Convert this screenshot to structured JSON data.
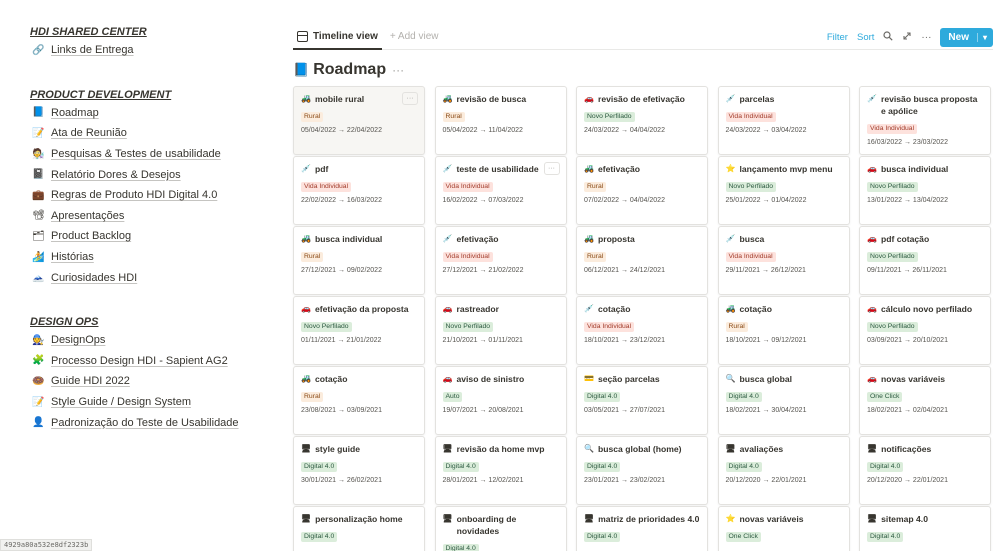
{
  "sidebar": {
    "sections": [
      {
        "title": "HDI SHARED CENTER",
        "items": [
          {
            "label": "Links de Entrega",
            "icon": "🔗"
          }
        ]
      },
      {
        "title": "PRODUCT DEVELOPMENT",
        "items": [
          {
            "label": "Roadmap",
            "icon": "📘"
          },
          {
            "label": "Ata de Reunião",
            "icon": "📝"
          },
          {
            "label": "Pesquisas & Testes de usabilidade",
            "icon": "🧑‍🔬"
          },
          {
            "label": "Relatório Dores & Desejos",
            "icon": "📓"
          },
          {
            "label": "Regras de Produto HDI Digital 4.0",
            "icon": "💼"
          },
          {
            "label": "Apresentações",
            "icon": "📽"
          },
          {
            "label": "Product Backlog",
            "icon": "🗂"
          },
          {
            "label": "Histórias",
            "icon": "🏄"
          },
          {
            "label": "Curiosidades HDI",
            "icon": "🗻"
          }
        ]
      },
      {
        "title": "DESIGN OPS",
        "items": [
          {
            "label": "DesignOps",
            "icon": "🧑‍🔧"
          },
          {
            "label": "Processo Design HDI - Sapient AG2",
            "icon": "🧩"
          },
          {
            "label": "Guide HDI 2022",
            "icon": "🍩"
          },
          {
            "label": "Style Guide / Design System",
            "icon": "📝"
          },
          {
            "label": "Padronização do Teste de Usabilidade",
            "icon": "👤"
          }
        ]
      }
    ]
  },
  "header": {
    "view_tab": "Timeline view",
    "add_view": "+ Add view",
    "filter": "Filter",
    "sort": "Sort",
    "new_button": "New"
  },
  "page": {
    "icon": "📘",
    "title": "Roadmap",
    "more": "···"
  },
  "cards": [
    {
      "title": "mobile rural",
      "icon": "🚜",
      "tag": "Rural",
      "tag_kind": "rural",
      "date": "05/04/2022 → 22/04/2022",
      "highlighted": true
    },
    {
      "title": "revisão de busca",
      "icon": "🚜",
      "tag": "Rural",
      "tag_kind": "rural",
      "date": "05/04/2022 → 11/04/2022"
    },
    {
      "title": "revisão de efetivação",
      "icon": "🚗",
      "tag": "Novo Perfilado",
      "tag_kind": "novo",
      "date": "24/03/2022 → 04/04/2022"
    },
    {
      "title": "parcelas",
      "icon": "💉",
      "tag": "Vida Individual",
      "tag_kind": "vida",
      "date": "24/03/2022 → 03/04/2022"
    },
    {
      "title": "revisão busca proposta e apólice",
      "icon": "💉",
      "tag": "Vida Individual",
      "tag_kind": "vida",
      "date": "16/03/2022 → 23/03/2022"
    },
    {
      "title": "pdf",
      "icon": "💉",
      "tag": "Vida Individual",
      "tag_kind": "vida",
      "date": "22/02/2022 → 16/03/2022"
    },
    {
      "title": "teste de usabilidade",
      "icon": "💉",
      "tag": "Vida Individual",
      "tag_kind": "vida",
      "date": "16/02/2022 → 07/03/2022",
      "dots": true
    },
    {
      "title": "efetivação",
      "icon": "🚜",
      "tag": "Rural",
      "tag_kind": "rural",
      "date": "07/02/2022 → 04/04/2022"
    },
    {
      "title": "lançamento mvp menu",
      "icon": "⭐",
      "tag": "Novo Perfilado",
      "tag_kind": "novo",
      "date": "25/01/2022 → 01/04/2022"
    },
    {
      "title": "busca individual",
      "icon": "🚗",
      "tag": "Novo Perfilado",
      "tag_kind": "novo",
      "date": "13/01/2022 → 13/04/2022"
    },
    {
      "title": "busca individual",
      "icon": "🚜",
      "tag": "Rural",
      "tag_kind": "rural",
      "date": "27/12/2021 → 09/02/2022"
    },
    {
      "title": "efetivação",
      "icon": "💉",
      "tag": "Vida Individual",
      "tag_kind": "vida",
      "date": "27/12/2021 → 21/02/2022"
    },
    {
      "title": "proposta",
      "icon": "🚜",
      "tag": "Rural",
      "tag_kind": "rural",
      "date": "06/12/2021 → 24/12/2021"
    },
    {
      "title": "busca",
      "icon": "💉",
      "tag": "Vida Individual",
      "tag_kind": "vida",
      "date": "29/11/2021 → 26/12/2021"
    },
    {
      "title": "pdf cotação",
      "icon": "🚗",
      "tag": "Novo Perfilado",
      "tag_kind": "novo",
      "date": "09/11/2021 → 26/11/2021"
    },
    {
      "title": "efetivação da proposta",
      "icon": "🚗",
      "tag": "Novo Perfilado",
      "tag_kind": "novo",
      "date": "01/11/2021 → 21/01/2022"
    },
    {
      "title": "rastreador",
      "icon": "🚗",
      "tag": "Novo Perfilado",
      "tag_kind": "novo",
      "date": "21/10/2021 → 01/11/2021"
    },
    {
      "title": "cotação",
      "icon": "💉",
      "tag": "Vida Individual",
      "tag_kind": "vida",
      "date": "18/10/2021 → 23/12/2021"
    },
    {
      "title": "cotação",
      "icon": "🚜",
      "tag": "Rural",
      "tag_kind": "rural",
      "date": "18/10/2021 → 09/12/2021"
    },
    {
      "title": "cálculo novo perfilado",
      "icon": "🚗",
      "tag": "Novo Perfilado",
      "tag_kind": "novo",
      "date": "03/09/2021 → 20/10/2021"
    },
    {
      "title": "cotação",
      "icon": "🚜",
      "tag": "Rural",
      "tag_kind": "rural",
      "date": "23/08/2021 → 03/09/2021"
    },
    {
      "title": "aviso de sinistro",
      "icon": "🚗",
      "tag": "Auto",
      "tag_kind": "auto",
      "date": "19/07/2021 → 20/08/2021"
    },
    {
      "title": "seção parcelas",
      "icon": "💳",
      "tag": "Digital 4.0",
      "tag_kind": "digital",
      "date": "03/05/2021 → 27/07/2021"
    },
    {
      "title": "busca global",
      "icon": "🔍",
      "tag": "Digital 4.0",
      "tag_kind": "digital",
      "date": "18/02/2021 → 30/04/2021"
    },
    {
      "title": "novas variáveis",
      "icon": "🚗",
      "tag": "One Click",
      "tag_kind": "oneclick",
      "date": "18/02/2021 → 02/04/2021"
    },
    {
      "title": "style guide",
      "icon": "🖥",
      "tag": "Digital 4.0",
      "tag_kind": "digital",
      "date": "30/01/2021 → 26/02/2021"
    },
    {
      "title": "revisão da home mvp",
      "icon": "🖥",
      "tag": "Digital 4.0",
      "tag_kind": "digital",
      "date": "28/01/2021 → 12/02/2021"
    },
    {
      "title": "busca global (home)",
      "icon": "🔍",
      "tag": "Digital 4.0",
      "tag_kind": "digital",
      "date": "23/01/2021 → 23/02/2021"
    },
    {
      "title": "avaliações",
      "icon": "🖥",
      "tag": "Digital 4.0",
      "tag_kind": "digital",
      "date": "20/12/2020 → 22/01/2021"
    },
    {
      "title": "notificações",
      "icon": "🖥",
      "tag": "Digital 4.0",
      "tag_kind": "digital",
      "date": "20/12/2020 → 22/01/2021"
    },
    {
      "title": "personalização home",
      "icon": "🖥",
      "tag": "Digital 4.0",
      "tag_kind": "digital",
      "date": ""
    },
    {
      "title": "onboarding de novidades",
      "icon": "🖥",
      "tag": "Digital 4.0",
      "tag_kind": "digital",
      "date": ""
    },
    {
      "title": "matriz de prioridades 4.0",
      "icon": "🖥",
      "tag": "Digital 4.0",
      "tag_kind": "digital",
      "date": ""
    },
    {
      "title": "novas variáveis",
      "icon": "⭐",
      "tag": "One Click",
      "tag_kind": "oneclick",
      "date": ""
    },
    {
      "title": "sitemap 4.0",
      "icon": "🖥",
      "tag": "Digital 4.0",
      "tag_kind": "digital",
      "date": ""
    }
  ],
  "footer": {
    "hash": "4929a80a532e8df2323b"
  }
}
